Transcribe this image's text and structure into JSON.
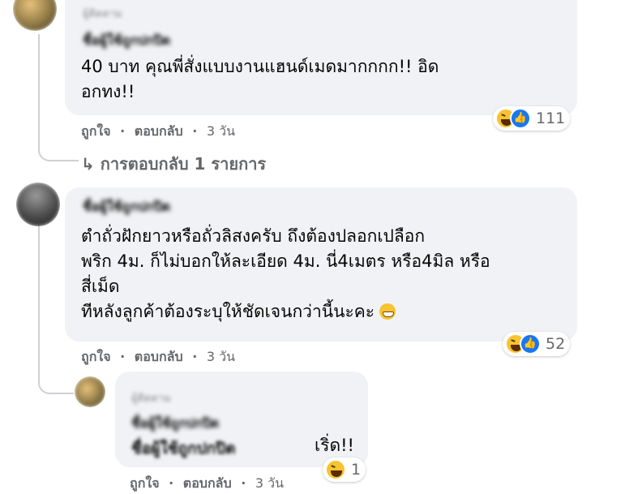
{
  "comments": [
    {
      "time_header": "ผู้ติดตาม",
      "author": "ชื่อผู้ใช้ถูกปกปิด",
      "text": "40 บาท คุณพี่สั่งแบบงานแฮนด์เมดมากกกก!! อิด\nอกทง!!",
      "reaction_count": "111",
      "reactions": [
        "haha-icon",
        "like-icon"
      ],
      "like_label": "ถูกใจ",
      "reply_label": "ตอบกลับ",
      "time": "3 วัน"
    },
    {
      "author": "ชื่อผู้ใช้ถูกปกปิด",
      "text": "ตำถั่วฝักยาวหรือถั่วลิสงครับ ถึงต้องปลอกเปลือก\nพริก 4ม. ก็ไม่บอกให้ละเอียด 4ม. นี่4เมตร หรือ4มิล หรือ\nสี่เม็ด\nทีหลังลูกค้าต้องระบุให้ชัดเจนกว่านี้นะคะ",
      "reaction_count": "52",
      "reactions": [
        "haha-icon",
        "like-icon"
      ],
      "like_label": "ถูกใจ",
      "reply_label": "ตอบกลับ",
      "time": "3 วัน"
    }
  ],
  "more_replies": "↳ การตอบกลับ 1 รายการ",
  "reply": {
    "time_header": "ผู้ติดตาม",
    "author": "ชื่อผู้ใช้ถูกปกปิด",
    "mention": "ชื่อผู้ใช้ถูกปกปิด",
    "text": "เริ่ด!!",
    "reaction_count": "1",
    "reactions": [
      "haha-icon"
    ],
    "like_label": "ถูกใจ",
    "reply_label": "ตอบกลับ",
    "time": "3 วัน"
  },
  "separator": "·",
  "colors": {
    "bubble": "#f0f2f5",
    "secondary_text": "#65676b",
    "like_blue": "#1877f2",
    "haha_yellow": "#f7c331"
  }
}
